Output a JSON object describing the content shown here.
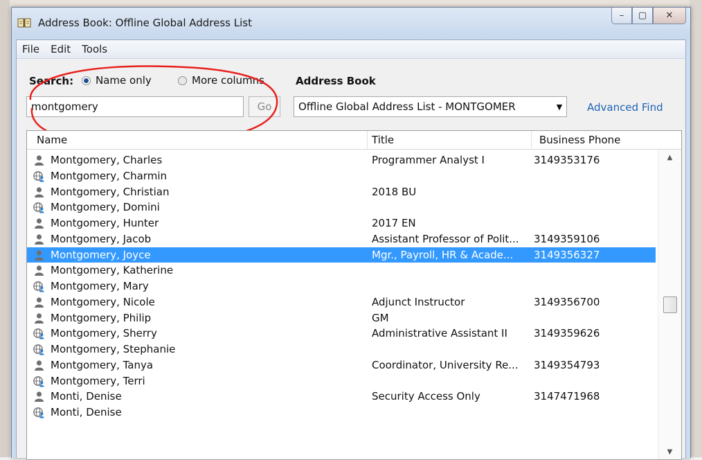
{
  "window": {
    "title": "Address Book: Offline Global Address List",
    "controls": {
      "minimize": "–",
      "maximize": "▢",
      "close": "✕"
    }
  },
  "menu": [
    "File",
    "Edit",
    "Tools"
  ],
  "search": {
    "label": "Search:",
    "option_name_only": "Name only",
    "option_more_columns": "More columns",
    "selected": "Name only",
    "value": "montgomery",
    "go_label": "Go"
  },
  "address_book": {
    "label": "Address Book",
    "selected": "Offline Global Address List - MONTGOMER",
    "advanced_find": "Advanced Find"
  },
  "list": {
    "columns": [
      "Name",
      "Title",
      "Business Phone"
    ],
    "rows": [
      {
        "icon": "person-icon",
        "name": "Montgomery, Charles",
        "title": "Programmer Analyst I",
        "phone": "3149353176"
      },
      {
        "icon": "globe-contact-icon",
        "name": "Montgomery, Charmin",
        "title": "",
        "phone": ""
      },
      {
        "icon": "person-icon",
        "name": "Montgomery, Christian",
        "title": "2018 BU",
        "phone": ""
      },
      {
        "icon": "globe-contact-icon",
        "name": "Montgomery, Domini",
        "title": "",
        "phone": ""
      },
      {
        "icon": "person-icon",
        "name": "Montgomery, Hunter",
        "title": "2017 EN",
        "phone": ""
      },
      {
        "icon": "person-icon",
        "name": "Montgomery, Jacob",
        "title": "Assistant Professor of Polit...",
        "phone": "3149359106"
      },
      {
        "icon": "person-icon",
        "name": "Montgomery, Joyce",
        "title": "Mgr., Payroll, HR & Acade...",
        "phone": "3149356327",
        "selected": true
      },
      {
        "icon": "person-icon",
        "name": "Montgomery, Katherine",
        "title": "",
        "phone": ""
      },
      {
        "icon": "globe-contact-icon",
        "name": "Montgomery, Mary",
        "title": "",
        "phone": ""
      },
      {
        "icon": "person-icon",
        "name": "Montgomery, Nicole",
        "title": "Adjunct Instructor",
        "phone": "3149356700"
      },
      {
        "icon": "person-icon",
        "name": "Montgomery, Philip",
        "title": "GM",
        "phone": ""
      },
      {
        "icon": "globe-contact-icon",
        "name": "Montgomery, Sherry",
        "title": "Administrative Assistant II",
        "phone": "3149359626"
      },
      {
        "icon": "globe-contact-icon",
        "name": "Montgomery, Stephanie",
        "title": "",
        "phone": ""
      },
      {
        "icon": "person-icon",
        "name": "Montgomery, Tanya",
        "title": "Coordinator, University Re...",
        "phone": "3149354793"
      },
      {
        "icon": "globe-contact-icon",
        "name": "Montgomery, Terri",
        "title": "",
        "phone": ""
      },
      {
        "icon": "person-icon",
        "name": "Monti, Denise",
        "title": "Security Access Only",
        "phone": "3147471968"
      },
      {
        "icon": "globe-contact-icon",
        "name": "Monti, Denise",
        "title": "",
        "phone": ""
      }
    ]
  },
  "colors": {
    "selection": "#3399ff",
    "link": "#1e64b4",
    "annotation": "#e8201c"
  }
}
